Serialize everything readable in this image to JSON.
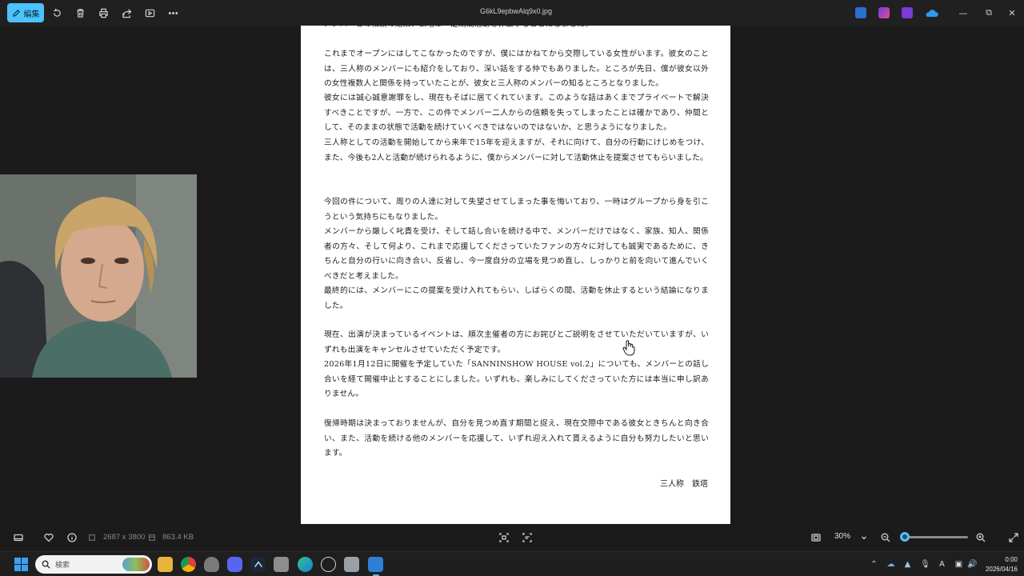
{
  "toolbar": {
    "edit_label": "編集",
    "file_title": "G6kL9epbwAlq9x0.jpg"
  },
  "document": {
    "paragraphs": [
      "メンバーとの相談の結果、鉄塔は一定期間活動を休止することにしました。",
      "これまでオープンにはしてこなかったのですが、僕にはかねてから交際している女性がいます。彼女のことは、三人称のメンバーにも紹介をしており、深い話をする仲でもありました。ところが先日、僕が彼女以外の女性複数人と関係を持っていたことが、彼女と三人称のメンバーの知るところとなりました。",
      "彼女には誠心誠意謝罪をし、現在もそばに居てくれています。このような話はあくまでプライベートで解決すべきことですが、一方で、この件でメンバー二人からの信頼を失ってしまったことは確かであり、仲間として、そのままの状態で活動を続けていくべきではないのではないか、と思うようになりました。",
      "三人称としての活動を開始してから来年で15年を迎えますが、それに向けて、自分の行動にけじめをつけ、また、今後も2人と活動が続けられるように、僕からメンバーに対して活動休止を提案させてもらいました。",
      "今回の件について、周りの人達に対して失望させてしまった事を悔いており、一時はグループから身を引こうという気持ちにもなりました。",
      "メンバーから厳しく叱責を受け、そして話し合いを続ける中で、メンバーだけではなく、家族、知人、関係者の方々、そして何より、これまで応援してくださっていたファンの方々に対しても誠実であるために、きちんと自分の行いに向き合い、反省し、今一度自分の立場を見つめ直し、しっかりと前を向いて進んでいくべきだと考えました。",
      "最終的には、メンバーにこの提案を受け入れてもらい、しばらくの間、活動を休止するという結論になりました。",
      "現在、出演が決まっているイベントは、順次主催者の方にお詫びとご説明をさせていただいていますが、いずれも出演をキャンセルさせていただく予定です。",
      "2026年1月12日に開催を予定していた「SANNINSHOW HOUSE vol.2」についても、メンバーとの話し合いを経て開催中止とすることにしました。いずれも、楽しみにしてくださっていた方には本当に申し訳ありません。",
      "復帰時期は決まっておりませんが、自分を見つめ直す期間と捉え、現在交際中である彼女ときちんと向き合い、また、活動を続ける他のメンバーを応援して、いずれ迎え入れて貰えるように自分も努力したいと思います。"
    ],
    "signature": "三人称　鉄塔"
  },
  "infobar": {
    "dimensions": "2687 x 3800",
    "filesize": "863.4 KB",
    "zoom": "30%",
    "zoom_fraction": 0.3
  },
  "taskbar": {
    "search_placeholder": "検索",
    "time": "0:00",
    "date": "2026/04/16"
  },
  "colors": {
    "accent": "#4cc2ff",
    "toolbar_bg": "#202020",
    "canvas_bg": "#1b1b1b"
  }
}
